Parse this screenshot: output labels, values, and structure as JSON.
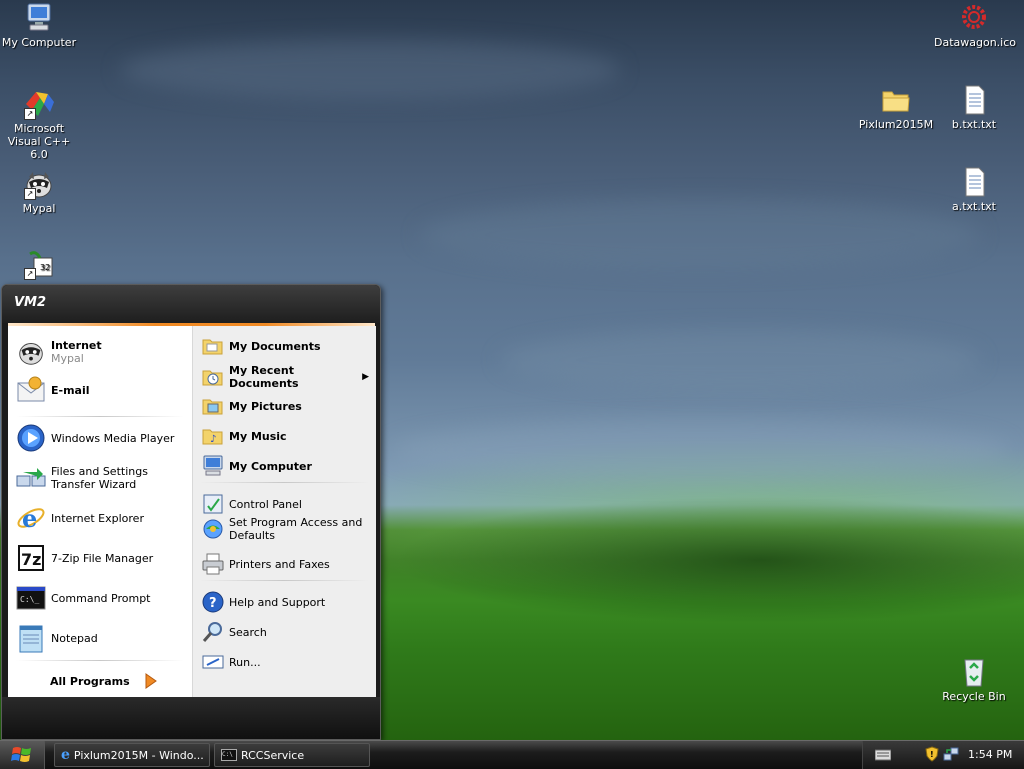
{
  "desktop_icons": {
    "my_computer": "My Computer",
    "msvc": "Microsoft Visual C++ 6.0",
    "mypal": "Mypal",
    "datawagon": "Datawagon.ico",
    "pixlum": "Pixlum2015M",
    "btxt": "b.txt.txt",
    "atxt": "a.txt.txt",
    "recycle": "Recycle Bin"
  },
  "start_menu": {
    "user": "VM2",
    "pinned": {
      "internet_label": "Internet",
      "internet_sub": "Mypal",
      "email_label": "E-mail"
    },
    "recent": [
      "Windows Media Player",
      "Files and Settings Transfer Wizard",
      "Internet Explorer",
      "7-Zip File Manager",
      "Command Prompt",
      "Notepad"
    ],
    "all_programs": "All Programs",
    "right": {
      "my_documents": "My Documents",
      "my_recent_documents": "My Recent Documents",
      "my_pictures": "My Pictures",
      "my_music": "My Music",
      "my_computer": "My Computer",
      "control_panel": "Control Panel",
      "set_program_access": "Set Program Access and Defaults",
      "printers_faxes": "Printers and Faxes",
      "help_support": "Help and Support",
      "search": "Search",
      "run": "Run..."
    }
  },
  "taskbar": {
    "task1": "Pixlum2015M - Windo...",
    "task2": "RCCService",
    "clock": "1:54 PM"
  },
  "colors": {
    "accent_orange": "#f08a24",
    "taskbar_dark": "#1c1c1c"
  }
}
